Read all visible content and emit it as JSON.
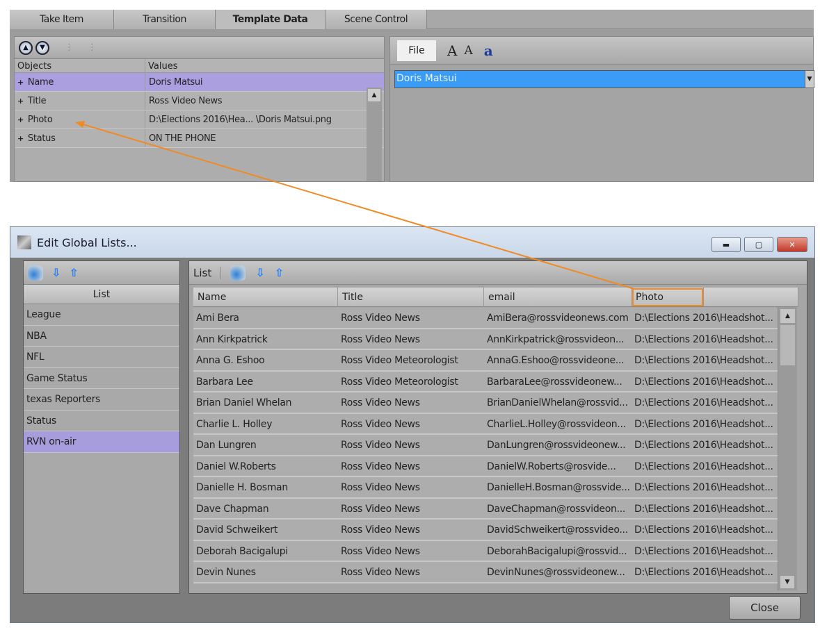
{
  "top": {
    "tabs": [
      "Take Item",
      "Transition",
      "Template Data",
      "Scene Control"
    ],
    "active_tab": "Template Data",
    "columns": [
      "Objects",
      "Values"
    ],
    "rows": [
      {
        "object": "Name",
        "value": "Doris Matsui"
      },
      {
        "object": "Title",
        "value": "Ross Video News"
      },
      {
        "object": "Photo",
        "value": "D:\\Elections 2016\\Hea... \\Doris Matsui.png"
      },
      {
        "object": "Status",
        "value": "ON THE PHONE"
      }
    ],
    "right_toolbar": {
      "file": "File",
      "grow": "A",
      "shrink": "A",
      "style": "a"
    },
    "combo_value": "Doris Matsui"
  },
  "dialog": {
    "title": "Edit Global Lists...",
    "lists_header": "List",
    "lists": [
      "League",
      "NBA",
      "NFL",
      "Game Status",
      "texas Reporters",
      "Status",
      "RVN on-air"
    ],
    "selected_list": "RVN on-air",
    "grid_label": "List",
    "columns": [
      "Name",
      "Title",
      "email",
      "Photo"
    ],
    "rows": [
      [
        "Ami Bera",
        "Ross Video News",
        "AmiBera@rossvideonews.com",
        "D:\\Elections 2016\\Headshot..."
      ],
      [
        "Ann Kirkpatrick",
        "Ross Video News",
        "AnnKirkpatrick@rossvideon...",
        "D:\\Elections 2016\\Headshot..."
      ],
      [
        "Anna G. Eshoo",
        "Ross Video Meteorologist",
        "AnnaG.Eshoo@rossvideone...",
        "D:\\Elections 2016\\Headshot..."
      ],
      [
        "Barbara Lee",
        "Ross Video Meteorologist",
        "BarbaraLee@rossvideonew...",
        "D:\\Elections 2016\\Headshot..."
      ],
      [
        "Brian Daniel Whelan",
        "Ross Video News",
        "BrianDanielWhelan@rossvid...",
        "D:\\Elections 2016\\Headshot..."
      ],
      [
        "Charlie L. Holley",
        "Ross Video News",
        "CharlieL.Holley@rossvideon...",
        "D:\\Elections 2016\\Headshot..."
      ],
      [
        "Dan Lungren",
        "Ross Video News",
        "DanLungren@rossvideonew...",
        "D:\\Elections 2016\\Headshot..."
      ],
      [
        "Daniel W.Roberts",
        "Ross Video News",
        "DanielW.Roberts@rosvide...",
        "D:\\Elections 2016\\Headshot..."
      ],
      [
        "Danielle H. Bosman",
        "Ross Video News",
        "DanielleH.Bosman@rossvide...",
        "D:\\Elections 2016\\Headshot..."
      ],
      [
        "Dave Chapman",
        "Ross Video News",
        "DaveChapman@rossvideon...",
        "D:\\Elections 2016\\Headshot..."
      ],
      [
        "David Schweikert",
        "Ross Video News",
        "DavidSchweikert@rossvideo...",
        "D:\\Elections 2016\\Headshot..."
      ],
      [
        "Deborah Bacigalupi",
        "Ross Video News",
        "DeborahBacigalupi@rossvid...",
        "D:\\Elections 2016\\Headshot..."
      ],
      [
        "Devin Nunes",
        "Ross Video News",
        "DevinNunes@rossvideonew...",
        "D:\\Elections 2016\\Headshot..."
      ]
    ],
    "close_label": "Close"
  },
  "colors": {
    "highlight": "#ab9fe0",
    "accent_arrow": "#f08a24",
    "combo": "#3a9cf5"
  }
}
